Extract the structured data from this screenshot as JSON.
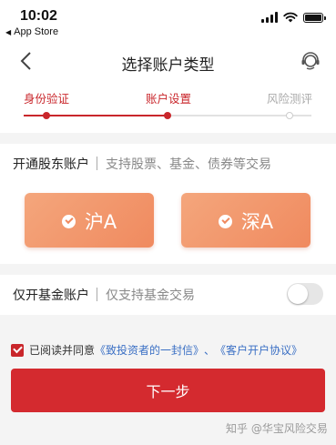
{
  "status_bar": {
    "time": "10:02",
    "back_app": "App Store"
  },
  "nav": {
    "title": "选择账户类型",
    "back_icon": "chevron-left-icon",
    "service_icon": "customer-service-icon"
  },
  "steps": [
    {
      "label": "身份验证",
      "state": "done"
    },
    {
      "label": "账户设置",
      "state": "current"
    },
    {
      "label": "风险测评",
      "state": "pending"
    }
  ],
  "progress_fraction": 0.5,
  "stock_account": {
    "title": "开通股东账户",
    "description": "支持股票、基金、债券等交易",
    "markets": [
      {
        "label": "沪A",
        "selected": true
      },
      {
        "label": "深A",
        "selected": true
      }
    ]
  },
  "fund_account": {
    "title": "仅开基金账户",
    "description": "仅支持基金交易",
    "toggle_on": false
  },
  "agreement": {
    "checked": true,
    "prefix": "已阅读并同意",
    "link1": "《致投资者的一封信》",
    "separator": "、",
    "link2": "《客户开户协议》"
  },
  "next_button": "下一步",
  "watermark": "知乎 @华宝风险交易",
  "colors": {
    "accent": "#d42a2f",
    "button_gradient_start": "#f4a67c",
    "button_gradient_end": "#f08a5f",
    "link": "#3a6fc4"
  }
}
